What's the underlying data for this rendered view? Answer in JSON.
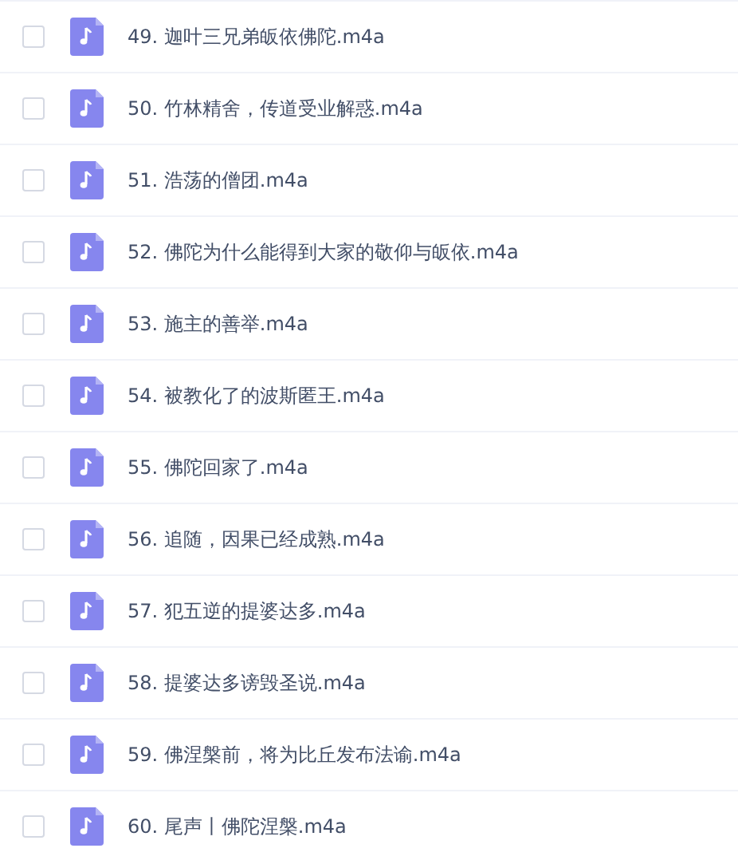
{
  "files": [
    {
      "name": "49. 迦叶三兄弟皈依佛陀.m4a",
      "checked": false
    },
    {
      "name": "50. 竹林精舍，传道受业解惑.m4a",
      "checked": false
    },
    {
      "name": "51. 浩荡的僧团.m4a",
      "checked": false
    },
    {
      "name": "52. 佛陀为什么能得到大家的敬仰与皈依.m4a",
      "checked": false
    },
    {
      "name": "53. 施主的善举.m4a",
      "checked": false
    },
    {
      "name": "54. 被教化了的波斯匿王.m4a",
      "checked": false
    },
    {
      "name": "55. 佛陀回家了.m4a",
      "checked": false
    },
    {
      "name": "56. 追随，因果已经成熟.m4a",
      "checked": false
    },
    {
      "name": "57. 犯五逆的提婆达多.m4a",
      "checked": false
    },
    {
      "name": "58. 提婆达多谤毁圣说.m4a",
      "checked": false
    },
    {
      "name": "59. 佛涅槃前，将为比丘发布法谕.m4a",
      "checked": false
    },
    {
      "name": "60. 尾声丨佛陀涅槃.m4a",
      "checked": false
    }
  ]
}
